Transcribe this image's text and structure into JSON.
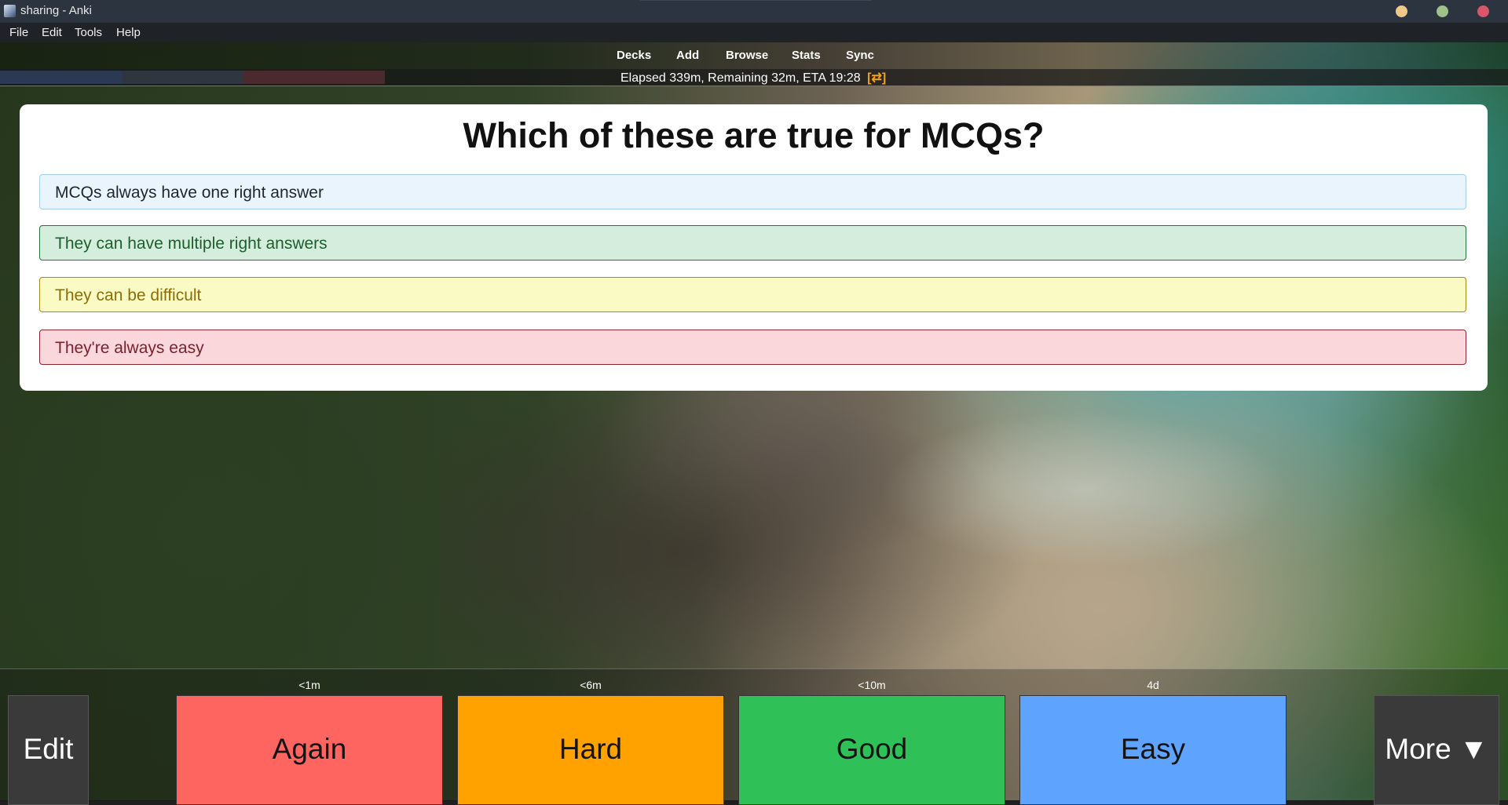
{
  "window": {
    "title": "sharing - Anki"
  },
  "menu": {
    "items": [
      {
        "label": "File"
      },
      {
        "label": "Edit"
      },
      {
        "label": "Tools"
      },
      {
        "label": "Help"
      }
    ]
  },
  "toolbar": {
    "links": [
      "Decks",
      "Add",
      "Browse",
      "Stats",
      "Sync"
    ]
  },
  "status": {
    "text": "Elapsed 339m, Remaining 32m, ETA 19:28",
    "icon_text": "[⇄]"
  },
  "card": {
    "question": "Which of these are true for MCQs?",
    "answers": [
      "MCQs always have one right answer",
      "They can have multiple right answers",
      "They can be difficult",
      "They're always easy"
    ]
  },
  "review": {
    "edit_label": "Edit",
    "more_label": "More ▼",
    "buttons": [
      {
        "label": "Again",
        "interval": "<1m",
        "color": "#ff6560"
      },
      {
        "label": "Hard",
        "interval": "<6m",
        "color": "#ffa200"
      },
      {
        "label": "Good",
        "interval": "<10m",
        "color": "#2fc058"
      },
      {
        "label": "Easy",
        "interval": "4d",
        "color": "#5ea4ff"
      }
    ]
  },
  "icons": {
    "app": "anki-app-icon",
    "window_controls": [
      "minimize-icon",
      "maximize-icon",
      "close-icon"
    ]
  }
}
